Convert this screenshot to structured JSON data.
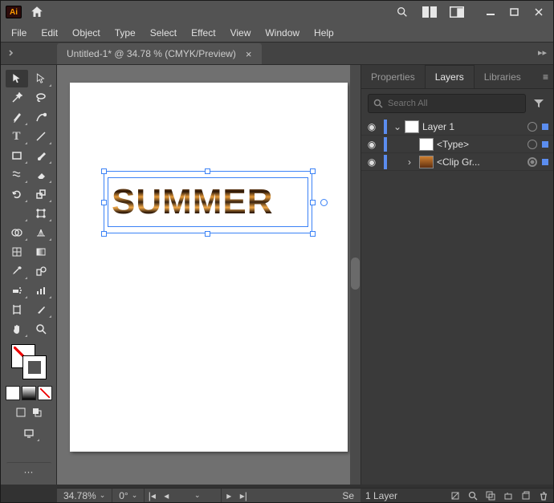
{
  "app": {
    "badge": "Ai"
  },
  "menus": [
    "File",
    "Edit",
    "Object",
    "Type",
    "Select",
    "Effect",
    "View",
    "Window",
    "Help"
  ],
  "tab": {
    "title": "Untitled-1* @ 34.78 % (CMYK/Preview)",
    "close": "×"
  },
  "canvas": {
    "text": "SUMMER"
  },
  "panel": {
    "tabs": {
      "properties": "Properties",
      "layers": "Layers",
      "libraries": "Libraries"
    },
    "search_placeholder": "Search All",
    "layers": [
      {
        "name": "Layer 1",
        "expanded": true,
        "depth": 0,
        "thumb": "page"
      },
      {
        "name": "<Type>",
        "expanded": null,
        "depth": 1,
        "thumb": "blank"
      },
      {
        "name": "<Clip Gr...",
        "expanded": false,
        "depth": 1,
        "thumb": "img",
        "targeted": true
      }
    ]
  },
  "status": {
    "zoom": "34.78%",
    "rotate": "0°",
    "layer_count": "1 Layer",
    "sel_hint": "Se"
  }
}
